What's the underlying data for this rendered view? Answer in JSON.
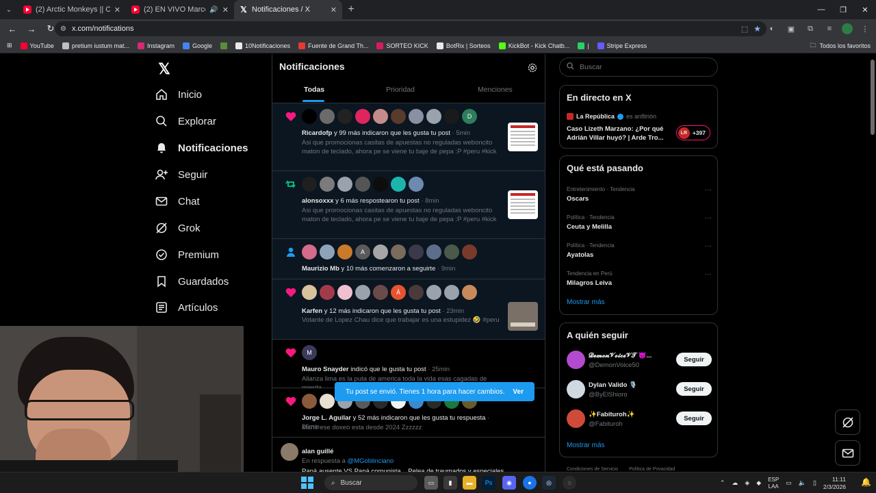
{
  "browser": {
    "tabs": [
      {
        "title": "(2) Arctic Monkeys || Crying Lightning",
        "icon": "youtube-icon",
        "active": false
      },
      {
        "title": "(2) EN VIVO Marco Sifuentes",
        "icon": "youtube-icon",
        "active": false
      },
      {
        "title": "Notificaciones / X",
        "icon": "x-logo-icon",
        "active": true
      }
    ],
    "new_tab": "+",
    "url": "x.com/notifications",
    "bookmarks": [
      {
        "label": "YouTube",
        "color": "#ff0033"
      },
      {
        "label": "pretium iustum mat...",
        "color": "#bdc1c6"
      },
      {
        "label": "Instagram",
        "color": "#d62976"
      },
      {
        "label": "Google",
        "color": "#4285f4"
      },
      {
        "label": "",
        "color": "#5b8c3a"
      },
      {
        "label": "10Notificaciones",
        "color": "#e7e9ea"
      },
      {
        "label": "Fuente de Grand Th...",
        "color": "#e53935"
      },
      {
        "label": "SORTEO KICK",
        "color": "#d81b60"
      },
      {
        "label": "BotRix | Sorteos",
        "color": "#e7e9ea"
      },
      {
        "label": "KickBot - Kick Chatb...",
        "color": "#53fc18"
      },
      {
        "label": "|",
        "color": "#25d366"
      },
      {
        "label": "Stripe Express",
        "color": "#635bff"
      }
    ],
    "all_favorites": "Todos los favoritos"
  },
  "nav": {
    "items": [
      {
        "label": "Inicio",
        "icon": "home-icon"
      },
      {
        "label": "Explorar",
        "icon": "search-icon"
      },
      {
        "label": "Notificaciones",
        "icon": "bell-icon",
        "active": true
      },
      {
        "label": "Seguir",
        "icon": "follow-icon"
      },
      {
        "label": "Chat",
        "icon": "mail-icon"
      },
      {
        "label": "Grok",
        "icon": "grok-icon"
      },
      {
        "label": "Premium",
        "icon": "premium-icon"
      },
      {
        "label": "Guardados",
        "icon": "bookmark-icon"
      },
      {
        "label": "Artículos",
        "icon": "articles-icon"
      }
    ]
  },
  "notifications": {
    "title": "Notificaciones",
    "tabs": [
      "Todas",
      "Prioridad",
      "Menciones"
    ],
    "items": [
      {
        "type": "like",
        "actor": "Ricardofp",
        "action": " y 99 más indicaron que les gusta tu post",
        "time": " · 5min",
        "body": "Asi que promocionas casitas de apuestas no reguladas weboncito maton de teclado, ahora pe se viene tu baje de pepa :P #peru #kick",
        "avatar_colors": [
          "#000000",
          "#6b6b6b",
          "#222222",
          "#e0245e",
          "#c48b8b",
          "#5a3a2a",
          "#8a8fa3",
          "#9aa3ad",
          "#1a1a1a",
          "#2e7d5b"
        ],
        "avatar_letters": [
          "",
          "",
          "",
          "",
          "",
          "",
          "",
          "",
          "",
          "D"
        ]
      },
      {
        "type": "repost",
        "actor": "alonsoxxx",
        "action": " y 6 más respostearon tu post",
        "time": " · 8min",
        "body": "Asi que promocionas casitas de apuestas no reguladas weboncito maton de teclado, ahora pe se viene tu baje de pepa :P #peru #kick",
        "avatar_colors": [
          "#1f1f1f",
          "#7b7b7b",
          "#9aa3ad",
          "#555555",
          "#0d0d0d",
          "#1cb5ac",
          "#6d8ab0"
        ],
        "avatar_letters": [
          "",
          "",
          "",
          "",
          "",
          "",
          ""
        ]
      },
      {
        "type": "follow",
        "actor": "Maurizio Mb",
        "action": " y 10 más comenzaron a seguirte",
        "time": " · 9min",
        "body": "",
        "avatar_colors": [
          "#d46a8c",
          "#8fa3b8",
          "#c97a2a",
          "#5a5a5a",
          "#a6a6a6",
          "#7a6b5c",
          "#3a3a4a",
          "#5c6e8c",
          "#4a5a4a",
          "#7a3a2a"
        ],
        "avatar_letters": [
          "",
          "",
          "",
          "A",
          "",
          "",
          "",
          "",
          "",
          ""
        ]
      },
      {
        "type": "like",
        "actor": "Karfen",
        "action": " y 12 más indicaron que les gusta tu post",
        "time": " · 23min",
        "body": "Votante de Lopez Chau dice que trabajar es una estupidez 🤣 #peru",
        "avatar_colors": [
          "#d9c39c",
          "#a33a4a",
          "#f0c0d0",
          "#9aa3ad",
          "#6b4a4a",
          "#e8532f",
          "#4a3a3a",
          "#9aa3ad",
          "#9aa3ad",
          "#c98a5a"
        ],
        "avatar_letters": [
          "",
          "",
          "",
          "",
          "",
          "Á",
          "",
          "",
          "",
          ""
        ]
      },
      {
        "type": "like",
        "actor": "Mauro Snayder",
        "action": " indicó que le gusta tu post",
        "time": " · 25min",
        "body": "Alianza lima es la puta de america toda la vida esas cagadas de mierda",
        "avatar_colors": [
          "#3a3a5a"
        ],
        "avatar_letters": [
          "M"
        ]
      },
      {
        "type": "like",
        "actor": "Jorge L. Aguilar",
        "action": " y 52 más indicaron que les gusta tu respuesta",
        "time": " · 26min",
        "body": "Mano ese doxeo esta desde 2024 Zzzzzz",
        "avatar_colors": [
          "#8a5a3a",
          "#e8e0d0",
          "#9aa3ad",
          "#5a5a5a",
          "#2a2a2a",
          "#f2f2f2",
          "#3a8ad0",
          "#2a2a2a",
          "#1a7a3a",
          "#6a5a2a"
        ],
        "avatar_letters": [
          "",
          "",
          "",
          "",
          "",
          "",
          "",
          "",
          "",
          ""
        ]
      },
      {
        "type": "reply",
        "actor": "alan guillé",
        "action": "",
        "time": "",
        "reply_prefix": "En respuesta a ",
        "reply_handle": "@MGoblinciano",
        "body": "Papá ausente VS Papá comunista... Pelea de traumados y especiales 🤓",
        "avatar_colors": [
          "#8a7a6a"
        ],
        "avatar_letters": [
          ""
        ]
      }
    ]
  },
  "search": {
    "placeholder": "Buscar"
  },
  "live": {
    "title": "En directo en X",
    "source": "La República",
    "host_note": "es anfitrión",
    "headline": "Caso Lizeth Marzano: ¿Por qué Adrián Villar huyó? | Arde Tro...",
    "badge": "LR",
    "count": "+397"
  },
  "trends": {
    "title": "Qué está pasando",
    "items": [
      {
        "meta": "Entretenimiento · Tendencia",
        "name": "Oscars"
      },
      {
        "meta": "Política · Tendencia",
        "name": "Ceuta y Melilla"
      },
      {
        "meta": "Política · Tendencia",
        "name": "Ayatolas"
      },
      {
        "meta": "Tendencia en Perú",
        "name": "Milagros Leiva"
      }
    ],
    "more_glyph": "···",
    "show_more": "Mostrar más"
  },
  "who_to_follow": {
    "title": "A quién seguir",
    "items": [
      {
        "name": "𝓓𝓮𝓶𝓸𝓷𝓥𝓸𝓲𝓬𝓮𝓥𝓣 😈...",
        "handle": "@DemonVoice50",
        "color": "#b34ad0"
      },
      {
        "name": "Dylan Valido 🎙️",
        "handle": "@ByElShioro",
        "color": "#d0d8e0"
      },
      {
        "name": "✨Fabituroh✨",
        "handle": "@Fabituroh",
        "color": "#d04a3a"
      }
    ],
    "follow_label": "Seguir",
    "show_more": "Mostrar más"
  },
  "toast": {
    "message": "Tu post se envió. Tienes 1 hora para hacer cambios.",
    "action": "Ver"
  },
  "footer": [
    "Condiciones de Servicio",
    "Política de Privacidad"
  ],
  "taskbar": {
    "search_label": "Buscar",
    "lang_top": "ESP",
    "lang_bottom": "LAA",
    "time": "11:11",
    "date": "2/3/2026"
  },
  "colors": {
    "accent": "#1d9bf0",
    "like": "#f91880",
    "repost": "#00ba7c",
    "background": "#000000"
  }
}
